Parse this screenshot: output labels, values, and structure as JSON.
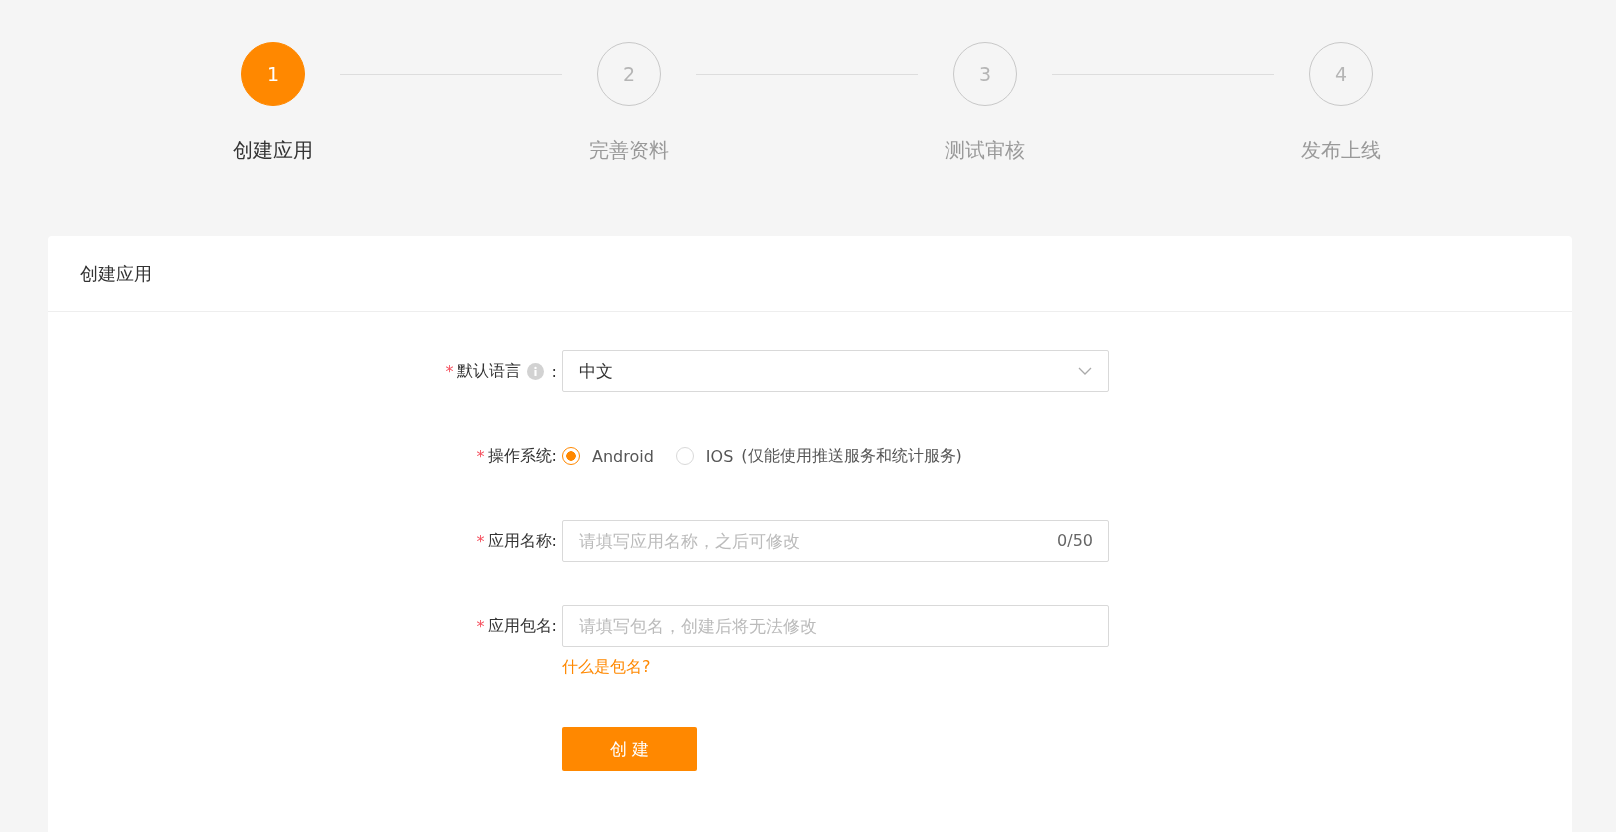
{
  "steps": [
    {
      "number": "1",
      "label": "创建应用",
      "selected": true
    },
    {
      "number": "2",
      "label": "完善资料",
      "selected": false
    },
    {
      "number": "3",
      "label": "测试审核",
      "selected": false
    },
    {
      "number": "4",
      "label": "发布上线",
      "selected": false
    }
  ],
  "card": {
    "title": "创建应用"
  },
  "form": {
    "fields": [
      {
        "kind": "select",
        "required_mark": "*",
        "label": "默认语言",
        "info": true,
        "colon": ":",
        "value": "中文"
      },
      {
        "kind": "radio",
        "required_mark": "*",
        "label": "操作系统:",
        "options": [
          {
            "label": "Android",
            "selected": true
          },
          {
            "label": "IOS",
            "note": "(仅能使用推送服务和统计服务)",
            "selected": false
          }
        ]
      },
      {
        "kind": "text",
        "required_mark": "*",
        "label": "应用名称:",
        "placeholder": "请填写应用名称，之后可修改",
        "counter": "0/50"
      },
      {
        "kind": "text",
        "required_mark": "*",
        "label": "应用包名:",
        "placeholder": "请填写包名，创建后将无法修改",
        "help_link": "什么是包名?"
      }
    ],
    "submit": "创 建"
  }
}
